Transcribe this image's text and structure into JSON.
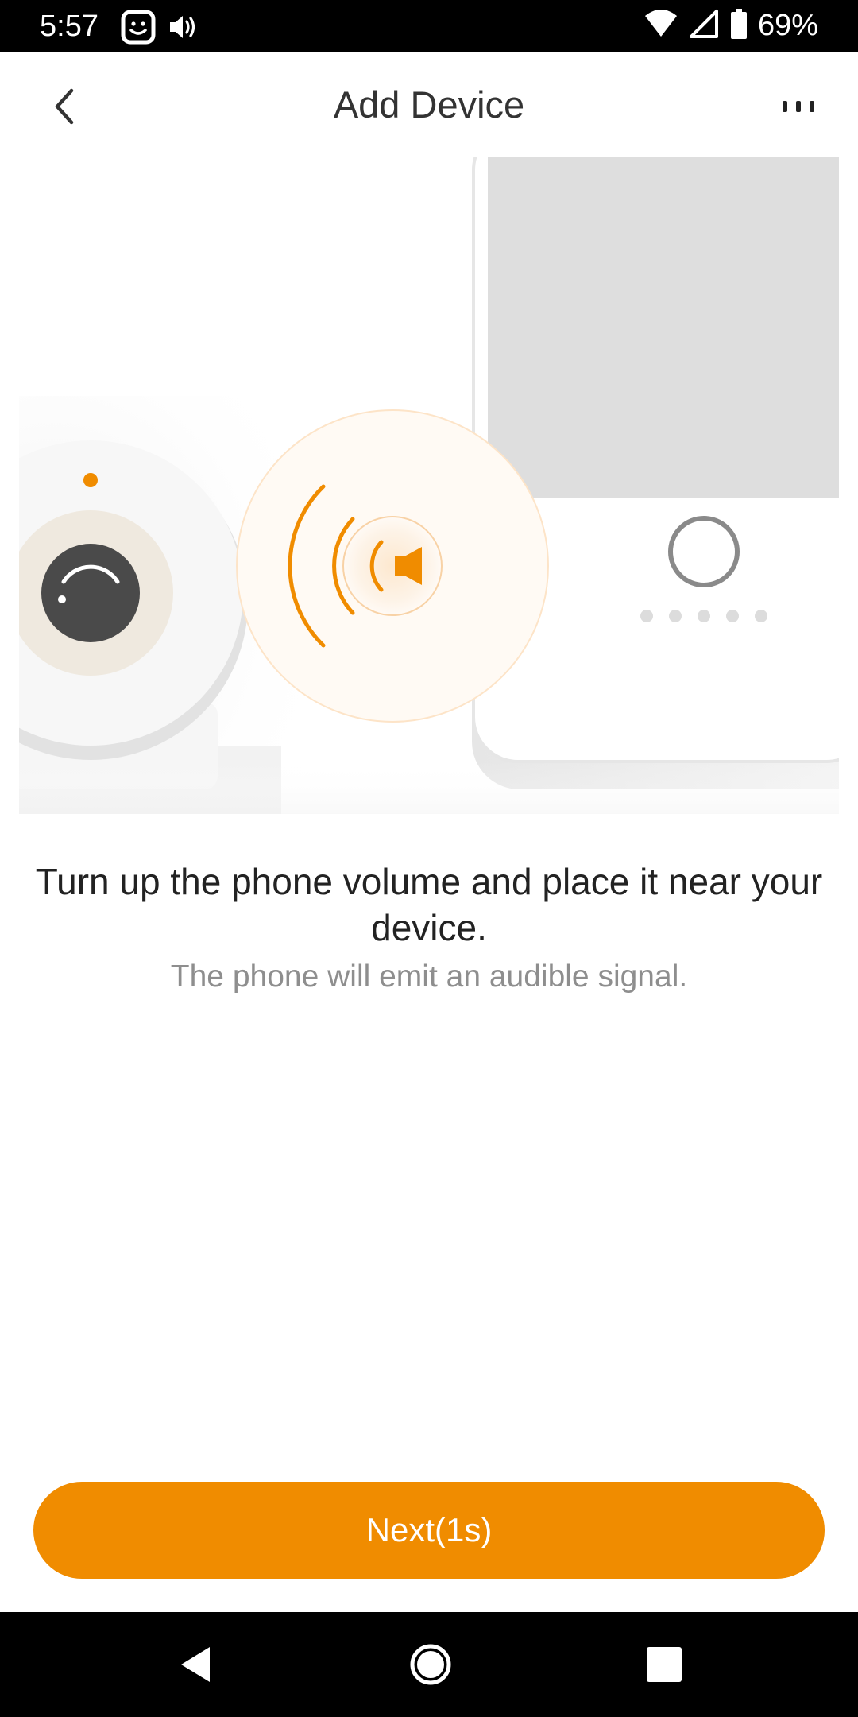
{
  "status_bar": {
    "time": "5:57",
    "battery_percent": "69%",
    "icons": [
      "face-notification-icon",
      "volume-icon",
      "wifi-icon",
      "signal-icon",
      "battery-icon"
    ]
  },
  "app_bar": {
    "title": "Add Device",
    "back_icon": "chevron-left-icon",
    "more_icon": "more-dots-icon"
  },
  "illustration": {
    "description_icons": [
      "camera-device",
      "sound-waves",
      "speaker-icon",
      "smartphone"
    ],
    "accent_color": "#f08c00",
    "page_dots": 5
  },
  "instruction": {
    "main": "Turn up the phone volume and place it near your device.",
    "sub": "The phone will emit an audible signal."
  },
  "actions": {
    "next_label": "Next(1s)",
    "next_color": "#f08c00"
  },
  "nav_bar": {
    "icons": [
      "nav-back-icon",
      "nav-home-icon",
      "nav-recents-icon"
    ]
  }
}
